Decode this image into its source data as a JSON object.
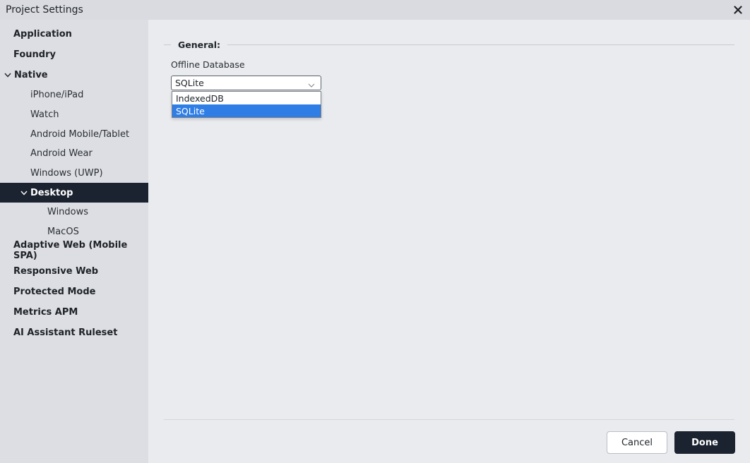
{
  "window": {
    "title": "Project Settings",
    "close_icon": "close-icon"
  },
  "sidebar": {
    "items": [
      {
        "label": "Application",
        "level": 0,
        "expanded": false,
        "selected": false
      },
      {
        "label": "Foundry",
        "level": 0,
        "expanded": false,
        "selected": false
      },
      {
        "label": "Native",
        "level": 0,
        "expanded": true,
        "selected": false
      },
      {
        "label": "iPhone/iPad",
        "level": 1,
        "expanded": false,
        "selected": false
      },
      {
        "label": "Watch",
        "level": 1,
        "expanded": false,
        "selected": false
      },
      {
        "label": "Android Mobile/Tablet",
        "level": 1,
        "expanded": false,
        "selected": false
      },
      {
        "label": "Android Wear",
        "level": 1,
        "expanded": false,
        "selected": false
      },
      {
        "label": "Windows (UWP)",
        "level": 1,
        "expanded": false,
        "selected": false
      },
      {
        "label": "Desktop",
        "level": 1,
        "expanded": true,
        "selected": true
      },
      {
        "label": "Windows",
        "level": 2,
        "expanded": false,
        "selected": false
      },
      {
        "label": "MacOS",
        "level": 2,
        "expanded": false,
        "selected": false
      },
      {
        "label": "Adaptive Web (Mobile SPA)",
        "level": 0,
        "expanded": false,
        "selected": false
      },
      {
        "label": "Responsive Web",
        "level": 0,
        "expanded": false,
        "selected": false
      },
      {
        "label": "Protected Mode",
        "level": 0,
        "expanded": false,
        "selected": false
      },
      {
        "label": "Metrics APM",
        "level": 0,
        "expanded": false,
        "selected": false
      },
      {
        "label": "AI Assistant Ruleset",
        "level": 0,
        "expanded": false,
        "selected": false
      }
    ]
  },
  "main": {
    "section_title": "General:",
    "offline_database": {
      "label": "Offline Database",
      "value": "SQLite",
      "options": [
        "IndexedDB",
        "SQLite"
      ],
      "highlighted_option": "SQLite",
      "open": true
    }
  },
  "footer": {
    "cancel_label": "Cancel",
    "done_label": "Done"
  },
  "colors": {
    "selected_nav_bg": "#1b2330",
    "dropdown_highlight": "#2f7ee6",
    "primary_button": "#1b2330",
    "background": "#e9ebee",
    "sidebar_bg": "#dcdee3"
  }
}
